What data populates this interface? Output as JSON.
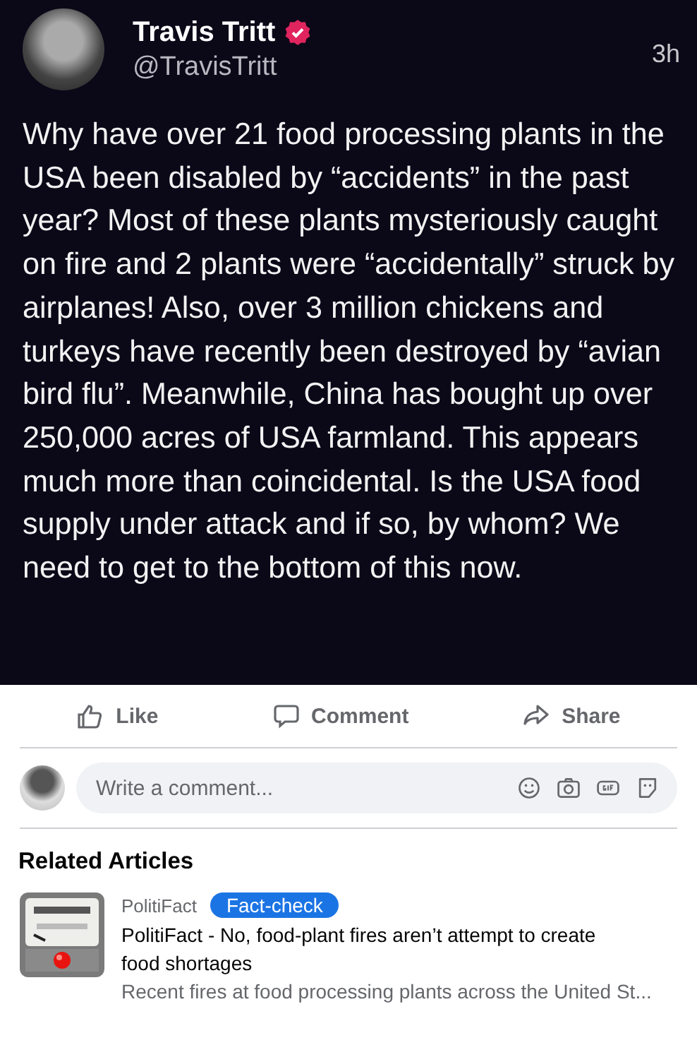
{
  "tweet": {
    "name": "Travis Tritt",
    "handle": "@TravisTritt",
    "time": "3h",
    "verified": true,
    "text": "Why have over 21 food processing plants in the USA been disabled by “accidents” in the past year? Most of these plants mysteriously caught on fire and 2 plants were “accidentally” struck by airplanes! Also, over 3 million chickens and turkeys have recently been destroyed by “avian bird flu”. Meanwhile, China has bought up over 250,000 acres of USA farmland. This appears much more than coincidental. Is the USA food supply under attack and if so, by whom? We need to get to the bottom of this now."
  },
  "actions": [
    {
      "kind": "like",
      "label": "Like"
    },
    {
      "kind": "comment",
      "label": "Comment"
    },
    {
      "kind": "share",
      "label": "Share"
    }
  ],
  "comment_box": {
    "placeholder": "Write a comment..."
  },
  "related": {
    "title": "Related Articles",
    "articles": [
      {
        "source": "PolitiFact",
        "badge": "Fact-check",
        "headline": "PolitiFact - No, food-plant fires aren’t attempt to create food shortages",
        "snippet": "Recent fires at food processing plants across the United St..."
      }
    ]
  }
}
